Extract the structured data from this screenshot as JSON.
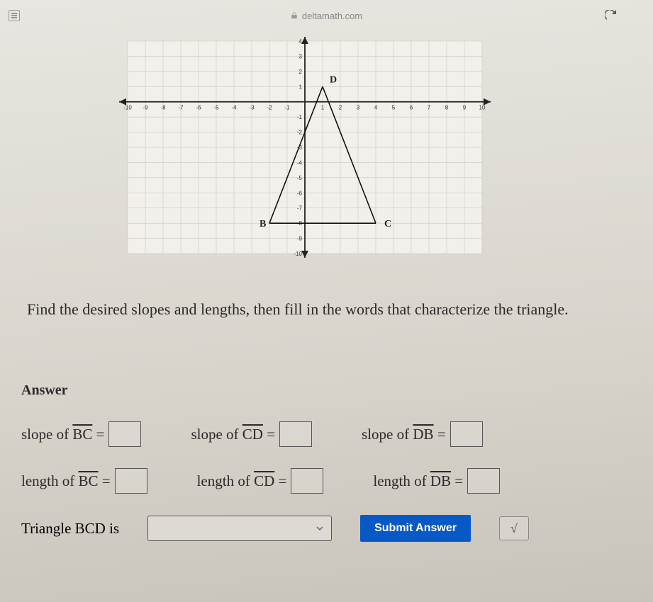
{
  "browser": {
    "url": "deltamath.com"
  },
  "chart_data": {
    "type": "scatter",
    "title": "",
    "xlabel": "",
    "ylabel": "",
    "xlim": [
      -10,
      10
    ],
    "ylim": [
      -10,
      4
    ],
    "grid": true,
    "points": [
      {
        "name": "B",
        "x": -2,
        "y": -8
      },
      {
        "name": "C",
        "x": 4,
        "y": -8
      },
      {
        "name": "D",
        "x": 1,
        "y": 1
      }
    ],
    "segments": [
      {
        "from": "B",
        "to": "C"
      },
      {
        "from": "C",
        "to": "D"
      },
      {
        "from": "D",
        "to": "B"
      }
    ]
  },
  "prompt": "Find the desired slopes and lengths, then fill in the words that characterize the triangle.",
  "answer": {
    "heading": "Answer",
    "slope_bc_label_pre": "slope of ",
    "slope_bc_seg": "BC",
    "slope_cd_label_pre": "slope of ",
    "slope_cd_seg": "CD",
    "slope_db_label_pre": "slope of ",
    "slope_db_seg": "DB",
    "length_bc_label_pre": "length of ",
    "length_bc_seg": "BC",
    "length_cd_label_pre": "length of ",
    "length_cd_seg": "CD",
    "length_db_label_pre": "length of ",
    "length_db_seg": "DB",
    "eq": " = ",
    "triangle_label": "Triangle BCD is",
    "submit": "Submit Answer",
    "sqrt_symbol": "√"
  }
}
